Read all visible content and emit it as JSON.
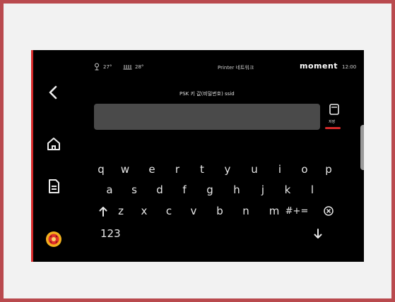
{
  "status_bar": {
    "temp1": "27°",
    "temp2": "28°",
    "title": "Printer 네트워크",
    "brand": "moment",
    "time": "12:00"
  },
  "field": {
    "label": "PSK 키 값(비밀번호) ssid",
    "value": ""
  },
  "save": {
    "label": "저장"
  },
  "keyboard": {
    "row1": [
      "q",
      "w",
      "e",
      "r",
      "t",
      "y",
      "u",
      "i",
      "o",
      "p"
    ],
    "row2": [
      "a",
      "s",
      "d",
      "f",
      "g",
      "h",
      "j",
      "k",
      "l"
    ],
    "row3": [
      "z",
      "x",
      "c",
      "v",
      "b",
      "n",
      "m",
      "#+="
    ],
    "numbers_key": "123"
  },
  "colors": {
    "accent": "#d42a2a",
    "frame": "#b94a4e",
    "field_bg": "#4a4a4a"
  },
  "icons": [
    "back-icon",
    "home-icon",
    "document-icon",
    "alert-icon",
    "thermometer-icon",
    "heater-icon",
    "save-icon",
    "shift-icon",
    "delete-icon",
    "enter-icon"
  ]
}
